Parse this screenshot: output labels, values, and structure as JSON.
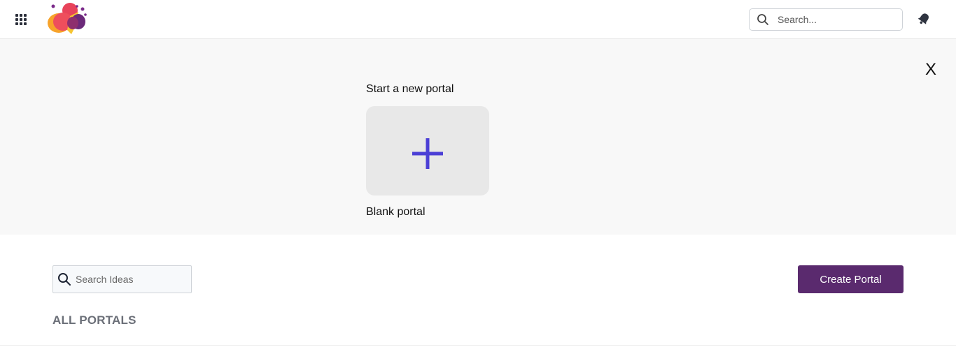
{
  "header": {
    "apps_icon": "apps-grid-icon",
    "logo_icon": "brand-logo",
    "search_placeholder": "Search...",
    "notifications_icon": "bell-icon"
  },
  "new_portal": {
    "close_label": "X",
    "title": "Start a new portal",
    "blank_icon": "plus-icon",
    "blank_label": "Blank portal",
    "accent_color": "#4b3fd6"
  },
  "portals": {
    "search_placeholder": "Search Ideas",
    "create_button_label": "Create Portal",
    "create_button_color": "#5a2a6e",
    "section_title": "ALL PORTALS"
  }
}
